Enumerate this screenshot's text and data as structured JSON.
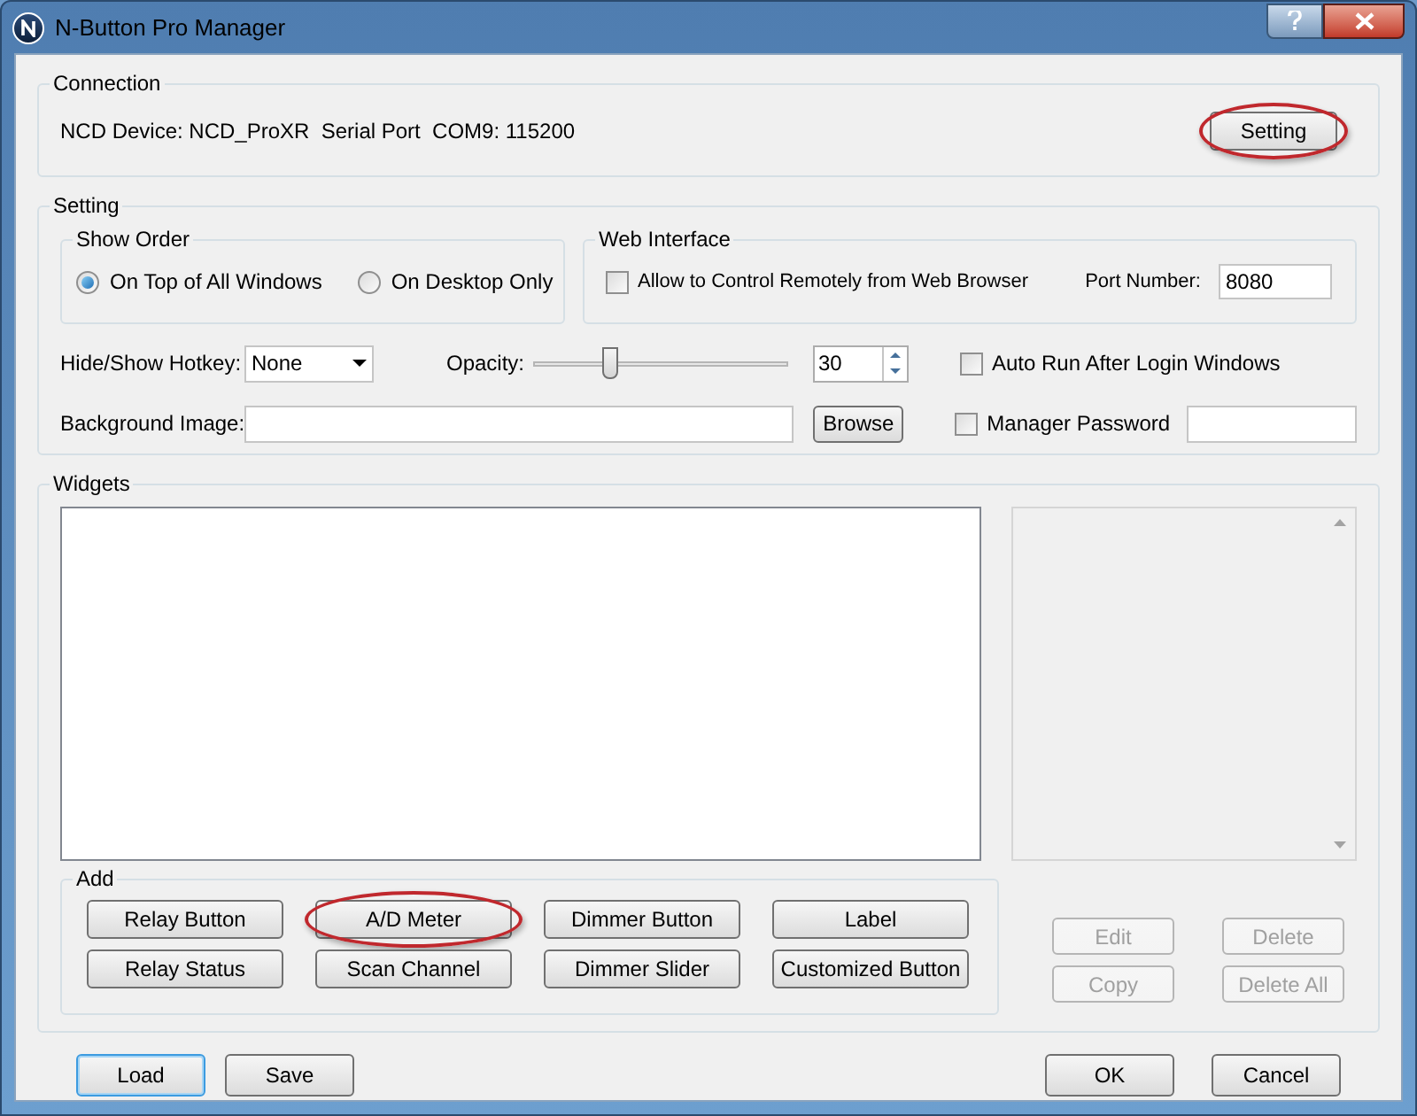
{
  "window": {
    "title": "N-Button Pro Manager"
  },
  "connection": {
    "title": "Connection",
    "info": "NCD Device: NCD_ProXR  Serial Port  COM9: 115200",
    "button": {
      "label": "Setting",
      "highlighted": true
    }
  },
  "setting": {
    "title": "Setting",
    "show_order": {
      "title": "Show Order",
      "options": [
        {
          "label": "On Top of All Windows",
          "selected": true
        },
        {
          "label": "On Desktop Only",
          "selected": false
        }
      ]
    },
    "web_interface": {
      "title": "Web Interface",
      "allow": {
        "label": "Allow to Control Remotely from Web Browser",
        "checked": false
      },
      "port_label": "Port Number:",
      "port": "8080"
    },
    "hotkey": {
      "label": "Hide/Show Hotkey:",
      "value": "None"
    },
    "opacity": {
      "label": "Opacity:",
      "level": 0.3,
      "value": "30"
    },
    "auto_run": {
      "label": "Auto Run After Login Windows",
      "checked": false
    },
    "background": {
      "label": "Background Image:",
      "button": "Browse"
    },
    "password": {
      "label": "Manager Password",
      "checked": false
    }
  },
  "widgets": {
    "title": "Widgets",
    "add": {
      "title": "Add",
      "buttons": [
        {
          "label": "Relay Button",
          "highlighted": false
        },
        {
          "label": "A/D Meter",
          "highlighted": true
        },
        {
          "label": "Dimmer Button",
          "highlighted": false
        },
        {
          "label": "Label",
          "highlighted": false
        },
        {
          "label": "Relay Status",
          "highlighted": false
        },
        {
          "label": "Scan Channel",
          "highlighted": false
        },
        {
          "label": "Dimmer Slider",
          "highlighted": false
        },
        {
          "label": "Customized Button",
          "highlighted": false
        }
      ]
    },
    "actions": [
      {
        "label": "Edit",
        "disabled": true
      },
      {
        "label": "Delete",
        "disabled": true
      },
      {
        "label": "Copy",
        "disabled": true
      },
      {
        "label": "Delete All",
        "disabled": true
      }
    ]
  },
  "footer": {
    "left": [
      {
        "label": "Load",
        "focused": true
      },
      {
        "label": "Save",
        "focused": false
      }
    ],
    "right": [
      {
        "label": "OK",
        "focused": false
      },
      {
        "label": "Cancel",
        "focused": false
      }
    ]
  }
}
